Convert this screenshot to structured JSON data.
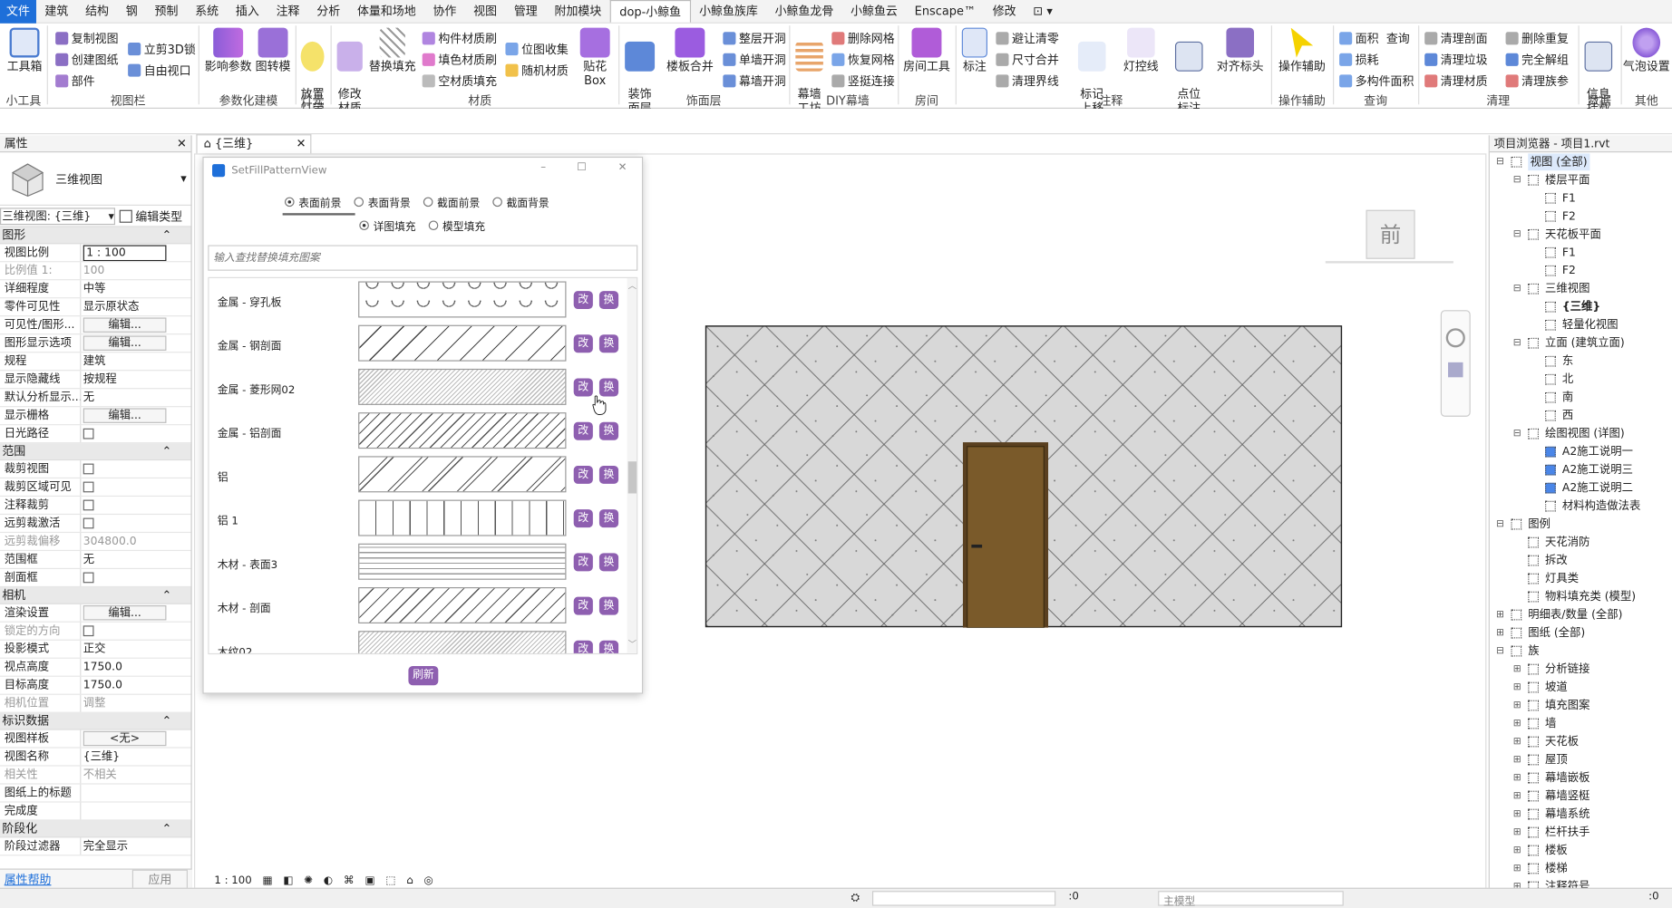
{
  "menubar": [
    "文件",
    "建筑",
    "结构",
    "钢",
    "预制",
    "系统",
    "插入",
    "注释",
    "分析",
    "体量和场地",
    "协作",
    "视图",
    "管理",
    "附加模块",
    "dop-小鲸鱼",
    "小鲸鱼族库",
    "小鲸鱼龙骨",
    "小鲸鱼云",
    "Enscape™",
    "修改",
    "⊡ ▾"
  ],
  "ribbon": {
    "toolbox": "工具箱",
    "g_small": "小工具",
    "copy_view": "复制视图",
    "create_sheet": "创建图纸",
    "component": "部件",
    "lock3d": "立剪3D锁",
    "free_view": "自由视口",
    "g_viewbar": "视图栏",
    "impact_param": "影响参数",
    "drawing_turn": "图转模",
    "g_param": "参数化建模",
    "place_light": "放置\n灯带",
    "g_light": "灯光",
    "modify_mat": "修改\n材质",
    "replace_fill": "替换填充",
    "comp_mat": "构件材质刷",
    "fill_mat": "填色材质刷",
    "empty_mat": "空材质填充",
    "bitmap": "位图收集",
    "random_mat": "随机材质",
    "g_mat": "材质",
    "tilebox": "贴花Box",
    "decor": "装饰\n面层",
    "floor_merge": "楼板合并",
    "whole_open": "整层开洞",
    "single_open": "单墙开洞",
    "curtain_open": "幕墙开洞",
    "g_facing": "饰面层",
    "curtain_wall": "幕墙\n工坊",
    "del_grid": "删除网格",
    "restore_grid": "恢复网格",
    "mullion": "竖挺连接",
    "g_diy": "DIY幕墙",
    "room_tool": "房间工具",
    "g_room": "房间",
    "dim": "标注",
    "avoid_clear": "避让清零",
    "dim_merge": "尺寸合并",
    "clear_bound": "清理界线",
    "tag_up": "标记\n上移",
    "light_line": "灯控线",
    "point_tag": "点位\n标注",
    "align_head": "对齐标头",
    "g_anno": "注释",
    "op_assist": "操作辅助",
    "g_op": "操作辅助",
    "area": "面积",
    "query": "查询",
    "loss": "损耗",
    "multi_area": "多构件面积",
    "g_query": "查询",
    "clear_section": "清理剖面",
    "clear_junk": "清理垃圾",
    "clear_mat": "清理材质",
    "del_dup": "删除重复",
    "full_ungroup": "完全解组",
    "clear_family": "清理族参",
    "g_clear": "清理",
    "info_mount": "信息\n挂载",
    "g_data": "数据",
    "gas_set": "气泡设置",
    "g_other": "其他"
  },
  "properties": {
    "title": "属性",
    "type_name": "三维视图",
    "selector": "三维视图: {三维}",
    "edit_type": "编辑类型",
    "sec_graphics": "图形",
    "rows_graphics": [
      {
        "k": "视图比例",
        "v": "1 : 100",
        "box": true
      },
      {
        "k": "比例值 1:",
        "v": "100",
        "dim": true
      },
      {
        "k": "详细程度",
        "v": "中等"
      },
      {
        "k": "零件可见性",
        "v": "显示原状态"
      },
      {
        "k": "可见性/图形...",
        "v": "编辑...",
        "btn": true
      },
      {
        "k": "图形显示选项",
        "v": "编辑...",
        "btn": true
      },
      {
        "k": "规程",
        "v": "建筑"
      },
      {
        "k": "显示隐藏线",
        "v": "按规程"
      },
      {
        "k": "默认分析显示...",
        "v": "无"
      },
      {
        "k": "显示栅格",
        "v": "编辑...",
        "btn": true
      },
      {
        "k": "日光路径",
        "v": "",
        "chk": true
      }
    ],
    "sec_extent": "范围",
    "rows_extent": [
      {
        "k": "裁剪视图",
        "v": "",
        "chk": true
      },
      {
        "k": "裁剪区域可见",
        "v": "",
        "chk": true
      },
      {
        "k": "注释裁剪",
        "v": "",
        "chk": true
      },
      {
        "k": "远剪裁激活",
        "v": "",
        "chk": true
      },
      {
        "k": "远剪裁偏移",
        "v": "304800.0",
        "dim": true
      },
      {
        "k": "范围框",
        "v": "无"
      },
      {
        "k": "剖面框",
        "v": "",
        "chk": true
      }
    ],
    "sec_camera": "相机",
    "rows_camera": [
      {
        "k": "渲染设置",
        "v": "编辑...",
        "btn": true
      },
      {
        "k": "锁定的方向",
        "v": "",
        "chk": true,
        "dim": true
      },
      {
        "k": "投影模式",
        "v": "正交"
      },
      {
        "k": "视点高度",
        "v": "1750.0"
      },
      {
        "k": "目标高度",
        "v": "1750.0"
      },
      {
        "k": "相机位置",
        "v": "调整",
        "dim": true
      }
    ],
    "sec_ident": "标识数据",
    "rows_ident": [
      {
        "k": "视图样板",
        "v": "<无>",
        "btn": true
      },
      {
        "k": "视图名称",
        "v": "{三维}"
      },
      {
        "k": "相关性",
        "v": "不相关",
        "dim": true
      },
      {
        "k": "图纸上的标题",
        "v": ""
      },
      {
        "k": "完成度",
        "v": ""
      }
    ],
    "sec_phase": "阶段化",
    "rows_phase": [
      {
        "k": "阶段过滤器",
        "v": "完全显示"
      }
    ],
    "help": "属性帮助",
    "apply": "应用"
  },
  "doctab": {
    "label": "{三维}"
  },
  "view": {
    "nav_cube": "前",
    "scale": "1 : 100"
  },
  "dialog": {
    "title": "SetFillPatternView",
    "radios1": [
      {
        "label": "表面前景",
        "on": true
      },
      {
        "label": "表面背景",
        "on": false
      },
      {
        "label": "截面前景",
        "on": false
      },
      {
        "label": "截面背景",
        "on": false
      }
    ],
    "radios2": [
      {
        "label": "详图填充",
        "on": true
      },
      {
        "label": "模型填充",
        "on": false
      }
    ],
    "search_placeholder": "输入查找替换填充图案",
    "rows": [
      {
        "name": "金属 - 穿孔板",
        "pattern": "circles"
      },
      {
        "name": "金属 - 钢剖面",
        "pattern": "diag"
      },
      {
        "name": "金属 - 菱形网02",
        "pattern": "dense"
      },
      {
        "name": "金属 - 铝剖面",
        "pattern": "diag2"
      },
      {
        "name": "铝",
        "pattern": "diag3"
      },
      {
        "name": "铝 1",
        "pattern": "vert"
      },
      {
        "name": "木材 - 表面3",
        "pattern": "wood"
      },
      {
        "name": "木材 - 剖面",
        "pattern": "diag4"
      },
      {
        "name": "木纹02",
        "pattern": "dense"
      }
    ],
    "edit_label": "改",
    "swap_label": "换",
    "refresh": "刷新"
  },
  "browser": {
    "title": "项目浏览器 - 项目1.rvt",
    "items": [
      {
        "t": "视图 (全部)",
        "lv": 0,
        "exp": "-",
        "hl": true
      },
      {
        "t": "楼层平面",
        "lv": 1,
        "exp": "-"
      },
      {
        "t": "F1",
        "lv": 2
      },
      {
        "t": "F2",
        "lv": 2
      },
      {
        "t": "天花板平面",
        "lv": 1,
        "exp": "-"
      },
      {
        "t": "F1",
        "lv": 2
      },
      {
        "t": "F2",
        "lv": 2
      },
      {
        "t": "三维视图",
        "lv": 1,
        "exp": "-"
      },
      {
        "t": "{三维}",
        "lv": 2,
        "bold": true
      },
      {
        "t": "轻量化视图",
        "lv": 2
      },
      {
        "t": "立面 (建筑立面)",
        "lv": 1,
        "exp": "-"
      },
      {
        "t": "东",
        "lv": 2
      },
      {
        "t": "北",
        "lv": 2
      },
      {
        "t": "南",
        "lv": 2
      },
      {
        "t": "西",
        "lv": 2
      },
      {
        "t": "绘图视图 (详图)",
        "lv": 1,
        "exp": "-"
      },
      {
        "t": "A2施工说明一",
        "lv": 2,
        "blue": true
      },
      {
        "t": "A2施工说明三",
        "lv": 2,
        "blue": true
      },
      {
        "t": "A2施工说明二",
        "lv": 2,
        "blue": true
      },
      {
        "t": "材料构造做法表",
        "lv": 2
      },
      {
        "t": "图例",
        "lv": 0,
        "exp": "-"
      },
      {
        "t": "天花消防",
        "lv": 1
      },
      {
        "t": "拆改",
        "lv": 1
      },
      {
        "t": "灯具类",
        "lv": 1
      },
      {
        "t": "物料填充类 (模型)",
        "lv": 1
      },
      {
        "t": "明细表/数量 (全部)",
        "lv": 0,
        "exp": "+"
      },
      {
        "t": "图纸 (全部)",
        "lv": 0,
        "exp": "+"
      },
      {
        "t": "族",
        "lv": 0,
        "exp": "-"
      },
      {
        "t": "分析链接",
        "lv": 1,
        "exp": "+"
      },
      {
        "t": "坡道",
        "lv": 1,
        "exp": "+"
      },
      {
        "t": "填充图案",
        "lv": 1,
        "exp": "+"
      },
      {
        "t": "墙",
        "lv": 1,
        "exp": "+"
      },
      {
        "t": "天花板",
        "lv": 1,
        "exp": "+"
      },
      {
        "t": "屋顶",
        "lv": 1,
        "exp": "+"
      },
      {
        "t": "幕墙嵌板",
        "lv": 1,
        "exp": "+"
      },
      {
        "t": "幕墙竖梃",
        "lv": 1,
        "exp": "+"
      },
      {
        "t": "幕墙系统",
        "lv": 1,
        "exp": "+"
      },
      {
        "t": "栏杆扶手",
        "lv": 1,
        "exp": "+"
      },
      {
        "t": "楼板",
        "lv": 1,
        "exp": "+"
      },
      {
        "t": "楼梯",
        "lv": 1,
        "exp": "+"
      },
      {
        "t": "注释符号",
        "lv": 1,
        "exp": "+"
      }
    ]
  },
  "status": {
    "zero": ":0",
    "model": "主模型",
    "zero2": ":0"
  },
  "colors": {
    "accent": "#1e6fd9",
    "purple": "#8e5fb0",
    "door": "#7a5a2a",
    "wall": "#d8d8d8"
  }
}
